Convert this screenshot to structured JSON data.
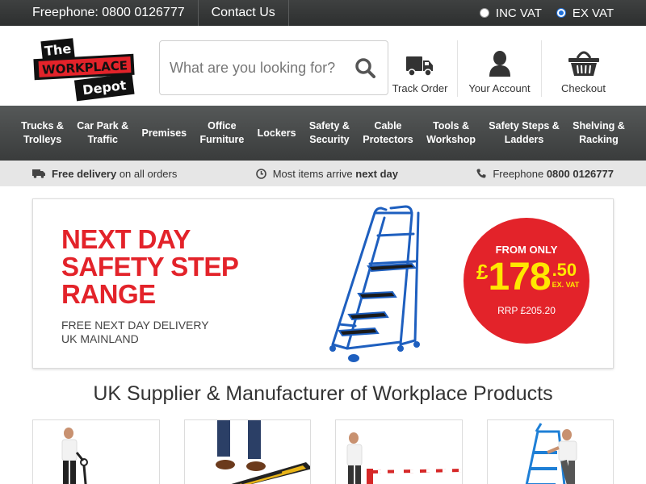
{
  "topbar": {
    "phone": "Freephone: 0800 0126777",
    "contact": "Contact Us",
    "vat_options": [
      "INC VAT",
      "EX VAT"
    ],
    "vat_selected": "EX VAT"
  },
  "header": {
    "logo_text": [
      "The",
      "WORKPLACE",
      "Depot"
    ],
    "search_placeholder": "What are you looking for?",
    "links": [
      {
        "label": "Track Order",
        "icon": "truck-icon"
      },
      {
        "label": "Your Account",
        "icon": "user-icon"
      },
      {
        "label": "Checkout",
        "icon": "basket-icon"
      }
    ]
  },
  "nav": [
    "Trucks &\nTrolleys",
    "Car Park &\nTraffic",
    "Premises",
    "Office\nFurniture",
    "Lockers",
    "Safety &\nSecurity",
    "Cable\nProtectors",
    "Tools &\nWorkshop",
    "Safety Steps &\nLadders",
    "Shelving &\nRacking"
  ],
  "strip": {
    "delivery_bold": "Free delivery",
    "delivery_rest": " on all orders",
    "arrive_rest": "Most items arrive ",
    "arrive_bold": "next day",
    "phone_rest": "Freephone ",
    "phone_bold": "0800 0126777"
  },
  "banner": {
    "headline": [
      "NEXT DAY",
      "SAFETY STEP",
      "RANGE"
    ],
    "sub": [
      "FREE NEXT DAY DELIVERY",
      "UK MAINLAND"
    ],
    "from_only": "FROM ONLY",
    "currency": "£",
    "amount": "178",
    "pence": ".50",
    "ex_vat": "EX. VAT",
    "rrp": "RRP £205.20"
  },
  "section_title": "UK Supplier & Manufacturer of Workplace Products",
  "colors": {
    "brand_red": "#e3232a",
    "price_yellow": "#ffe800",
    "nav_dark": "#3a3c3c"
  }
}
